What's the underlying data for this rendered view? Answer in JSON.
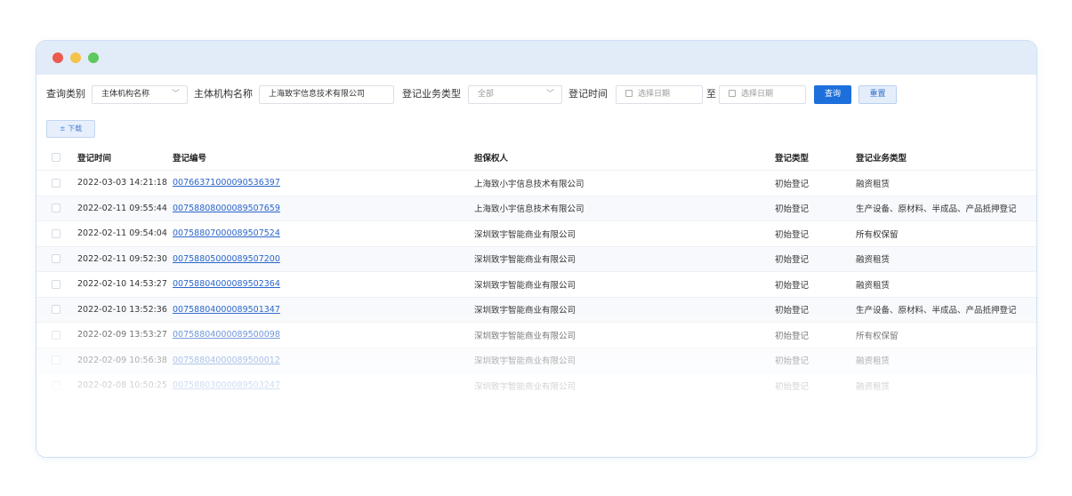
{
  "filters": {
    "query_type_label": "查询类别",
    "query_type_value": "主体机构名称",
    "entity_name_label": "主体机构名称",
    "entity_name_value": "上海致宇信息技术有限公司",
    "business_type_label": "登记业务类型",
    "business_type_value": "全部",
    "reg_time_label": "登记时间",
    "date_placeholder_start": "选择日期",
    "to_label": "至",
    "date_placeholder_end": "选择日期",
    "query_button": "查询",
    "reset_button": "重置"
  },
  "toolbar": {
    "download_label": "± 下载"
  },
  "table": {
    "headers": [
      "登记时间",
      "登记编号",
      "担保权人",
      "登记类型",
      "登记业务类型"
    ],
    "rows": [
      [
        "2022-03-03 14:21:18",
        "00766371000090536397",
        "上海致小宇信息技术有限公司",
        "初始登记",
        "融资租赁"
      ],
      [
        "2022-02-11 09:55:44",
        "00758808000089507659",
        "上海致小宇信息技术有限公司",
        "初始登记",
        "生产设备、原材料、半成品、产品抵押登记"
      ],
      [
        "2022-02-11 09:54:04",
        "00758807000089507524",
        "深圳致宇智能商业有限公司",
        "初始登记",
        "所有权保留"
      ],
      [
        "2022-02-11 09:52:30",
        "00758805000089507200",
        "深圳致宇智能商业有限公司",
        "初始登记",
        "融资租赁"
      ],
      [
        "2022-02-10 14:53:27",
        "00758804000089502364",
        "深圳致宇智能商业有限公司",
        "初始登记",
        "融资租赁"
      ],
      [
        "2022-02-10 13:52:36",
        "00758804000089501347",
        "深圳致宇智能商业有限公司",
        "初始登记",
        "生产设备、原材料、半成品、产品抵押登记"
      ],
      [
        "2022-02-09 13:53:27",
        "00758804000089500098",
        "深圳致宇智能商业有限公司",
        "初始登记",
        "所有权保留"
      ],
      [
        "2022-02-09 10:56:38",
        "00758804000089500012",
        "深圳致宇智能商业有限公司",
        "初始登记",
        "融资租赁"
      ],
      [
        "2022-02-08 10:50:25",
        "00758803000089503247",
        "深圳致宇智能商业有限公司",
        "初始登记",
        "融资租赁"
      ]
    ]
  }
}
